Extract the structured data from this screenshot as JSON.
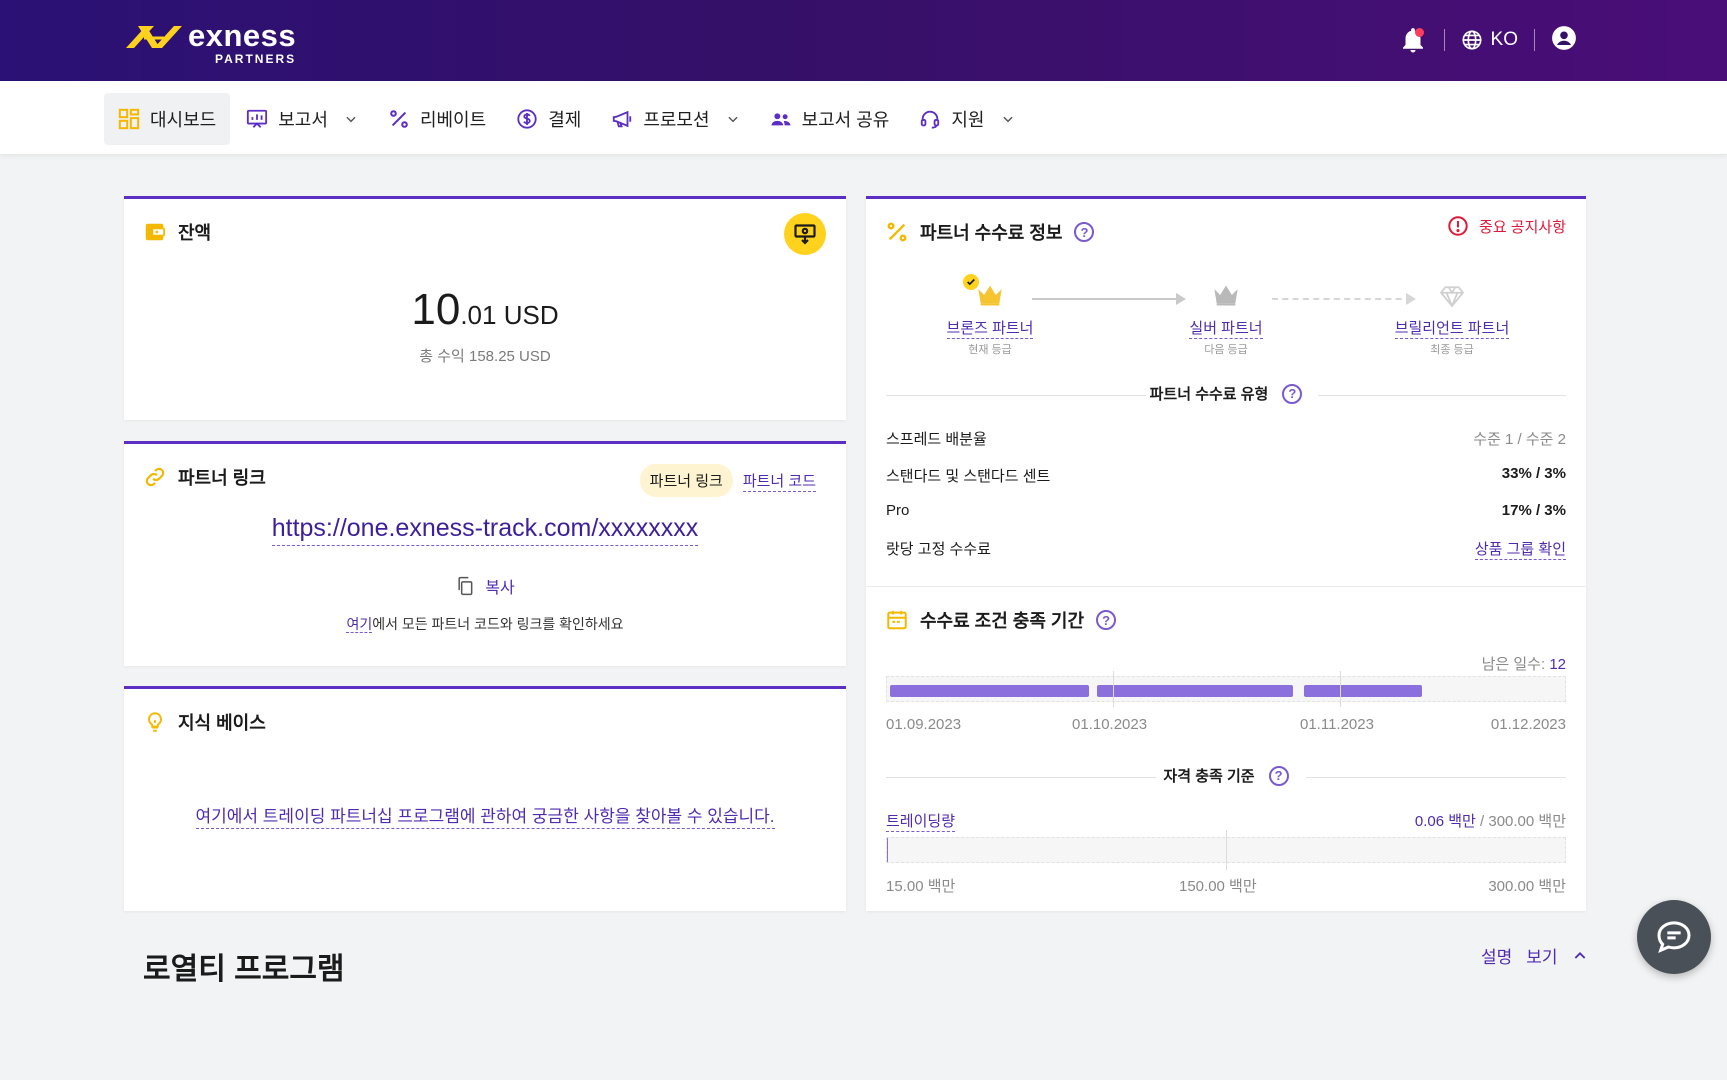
{
  "header": {
    "brand": "exness",
    "brand_sub": "PARTNERS",
    "language": "KO"
  },
  "nav": {
    "items": [
      {
        "label": "대시보드"
      },
      {
        "label": "보고서"
      },
      {
        "label": "리베이트"
      },
      {
        "label": "결제"
      },
      {
        "label": "프로모션"
      },
      {
        "label": "보고서 공유"
      },
      {
        "label": "지원"
      }
    ]
  },
  "balance": {
    "title": "잔액",
    "amount_int": "10",
    "amount_dec": ".01",
    "currency": "USD",
    "total_label": "총 수익 158.25 USD"
  },
  "partner_link": {
    "title": "파트너 링크",
    "tab_link": "파트너 링크",
    "tab_code": "파트너 코드",
    "url": "https://one.exness-track.com/xxxxxxxx",
    "copy_label": "복사",
    "note_link": "여기",
    "note_rest": "에서 모든 파트너 코드와 링크를 확인하세요"
  },
  "knowledge": {
    "title": "지식 베이스",
    "link": "여기에서 트레이딩 파트너십 프로그램에 관하여 궁금한 사항을 찾아볼 수 있습니다."
  },
  "commission": {
    "title": "파트너 수수료 정보",
    "notice": "중요 공지사항",
    "tiers": [
      {
        "name": "브론즈 파트너",
        "sub": "현재 등급"
      },
      {
        "name": "실버 파트너",
        "sub": "다음 등급"
      },
      {
        "name": "브릴리언트 파트너",
        "sub": "최종 등급"
      }
    ],
    "type_title": "파트너 수수료 유형",
    "rows": [
      {
        "label": "스프레드 배분율",
        "value": "수준 1 / 수준 2"
      },
      {
        "label": "스탠다드 및 스탠다드 센트",
        "value": "33% / 3%"
      },
      {
        "label": "Pro",
        "value": "17% / 3%"
      },
      {
        "label": "랏당 고정 수수료",
        "value": "상품 그룹 확인"
      }
    ]
  },
  "period": {
    "title": "수수료 조건 충족 기간",
    "days_label": "남은 일수:",
    "days_value": "12",
    "progress": [
      1.0,
      1.0,
      0.6
    ],
    "dates": [
      "01.09.2023",
      "01.10.2023",
      "01.11.2023",
      "01.12.2023"
    ],
    "criteria_title": "자격 충족 기준",
    "volume_label": "트레이딩량",
    "volume_value": "0.06 백만",
    "volume_total": " / 300.00 백만",
    "volume_progress": 0.0002,
    "scale": [
      "15.00 백만",
      "150.00 백만",
      "300.00 백만"
    ]
  },
  "loyalty": {
    "title": "로열티 프로그램",
    "desc": "설명",
    "view": "보기"
  },
  "colors": {
    "accent": "#5c2ec4",
    "link": "#4f2bb0",
    "yellow": "#ffd21e",
    "alert": "#e0193a"
  }
}
